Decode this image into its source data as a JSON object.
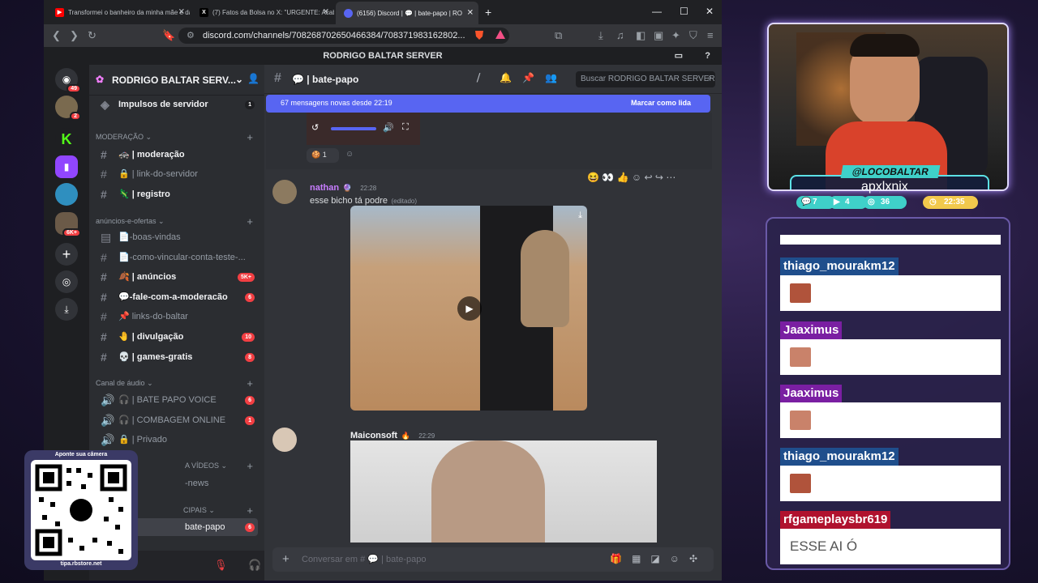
{
  "browser": {
    "tabs": [
      {
        "title": "Transformei o banheiro da minha mãe e da",
        "color": "#ff0000",
        "icon": "youtube-icon"
      },
      {
        "title": "(7) Fatos da Bolsa no X: \"URGENTE: Acabou",
        "color": "#000000",
        "icon": "x-icon"
      },
      {
        "title": "(6156) Discord | 💬 | bate-papo | RO",
        "color": "#5865f2",
        "icon": "discord-icon"
      }
    ],
    "url": "discord.com/channels/708268702650466384/708371983162802..."
  },
  "discord": {
    "server_title": "RODRIGO BALTAR SERVER",
    "server_name": "RODRIGO BALTAR SERV...",
    "guild_badges": [
      "49",
      "2",
      "6K+"
    ],
    "boost": {
      "label": "Impulsos de servidor",
      "count": "1"
    },
    "categories": {
      "moderacao": "MODERAÇÃO",
      "anuncios": "anúncios-e-ofertas",
      "audio": "Canal de áudio",
      "videos": "A VÍDEOS",
      "principais": "CIPAIS"
    },
    "channels": [
      {
        "label": "| moderação",
        "emoji": "🚓"
      },
      {
        "label": "| link-do-servidor",
        "emoji": "🔒"
      },
      {
        "label": "| registro",
        "emoji": "🦎"
      },
      {
        "label": "-boas-vindas",
        "emoji": "📄"
      },
      {
        "label": "-como-vincular-conta-teste-...",
        "emoji": "📄"
      },
      {
        "label": "| anúncios",
        "emoji": "🍂",
        "badge": "5K+"
      },
      {
        "label": "-fale-com-a-moderacão",
        "emoji": "💬",
        "badge": "6"
      },
      {
        "label": "links-do-baltar",
        "emoji": "📌"
      },
      {
        "label": "| divulgação",
        "emoji": "🤚",
        "badge": "10"
      },
      {
        "label": "| games-gratis",
        "emoji": "💀",
        "badge": "8"
      },
      {
        "label": "| BATE PAPO VOICE",
        "emoji": "🎧",
        "badge": "6"
      },
      {
        "label": "| COMBAGEM ONLINE",
        "emoji": "🎧",
        "badge": "1"
      },
      {
        "label": "| Privado",
        "emoji": "🔒"
      },
      {
        "label": "-news",
        "emoji": ""
      },
      {
        "label": "bate-papo",
        "emoji": "",
        "badge": "6"
      }
    ],
    "header": {
      "channel": "| bate-papo",
      "search": "Buscar RODRIGO BALTAR SERVER"
    },
    "new_messages": {
      "text": "67 mensagens novas desde 22:19",
      "mark": "Marcar como lida"
    },
    "reaction_count": "1",
    "messages": [
      {
        "author": "nathan",
        "time": "22:28",
        "text": "esse bicho tá podre",
        "edited": "(editado)",
        "color": "#c77dff"
      },
      {
        "author": "Maiconsoft",
        "time": "22:29",
        "color": "#f2f3f5"
      }
    ],
    "composer": "Conversar em # 💬 | bate-papo"
  },
  "qr": {
    "top": "Aponte sua câmera",
    "bottom": "tipa.rbstore.net"
  },
  "stream": {
    "handle": "@LOCOBALTAR",
    "title": "apxlxnix",
    "stats": [
      "7",
      "4",
      "36",
      "22:35"
    ]
  },
  "chat": [
    {
      "user": "thiago_mourakm12",
      "color": "#1f4e8c",
      "text": ""
    },
    {
      "user": "Jaaximus",
      "color": "#7a1fa2",
      "text": ""
    },
    {
      "user": "Jaaximus",
      "color": "#7a1fa2",
      "text": ""
    },
    {
      "user": "thiago_mourakm12",
      "color": "#1f4e8c",
      "text": ""
    },
    {
      "user": "rfgameplaysbr619",
      "color": "#b0122e",
      "text": "ESSE AI Ó"
    }
  ]
}
